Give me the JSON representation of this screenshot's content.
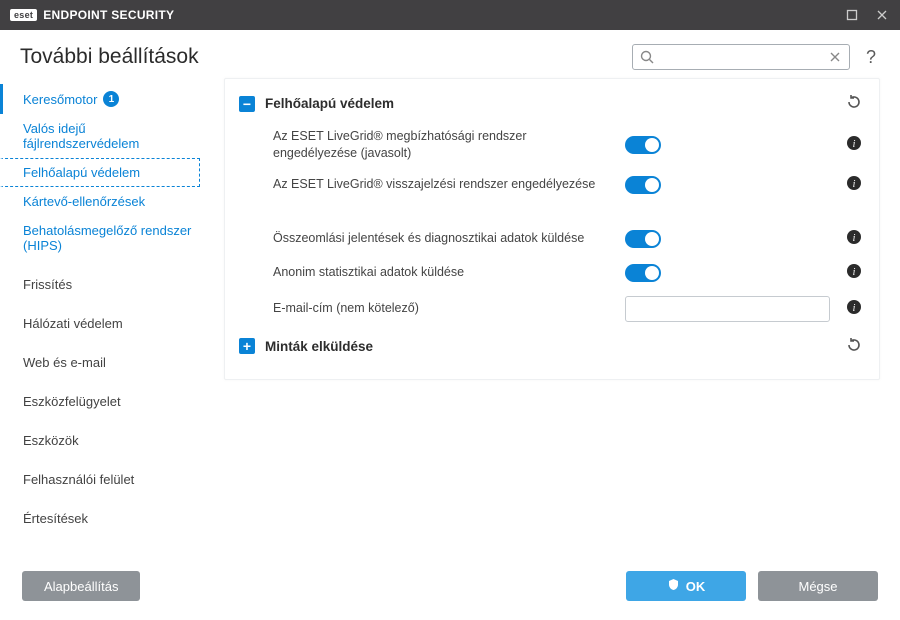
{
  "title_bar": {
    "brand_badge": "eset",
    "brand_text": "ENDPOINT SECURITY"
  },
  "header": {
    "title": "További beállítások",
    "help": "?",
    "search": {
      "value": "",
      "placeholder": ""
    }
  },
  "sidebar": {
    "engine": {
      "label": "Keresőmotor",
      "badge": "1"
    },
    "realtime": {
      "label": "Valós idejű fájlrendszervédelem"
    },
    "cloud": {
      "label": "Felhőalapú védelem"
    },
    "malware": {
      "label": "Kártevő-ellenőrzések"
    },
    "hips": {
      "label": "Behatolásmegelőző rendszer (HIPS)"
    },
    "update": {
      "label": "Frissítés"
    },
    "network": {
      "label": "Hálózati védelem"
    },
    "web": {
      "label": "Web és e-mail"
    },
    "device": {
      "label": "Eszközfelügyelet"
    },
    "tools": {
      "label": "Eszközök"
    },
    "ui": {
      "label": "Felhasználói felület"
    },
    "notif": {
      "label": "Értesítések"
    }
  },
  "section1": {
    "title": "Felhőalapú védelem",
    "rows": {
      "livegrid_rep": "Az ESET LiveGrid® megbízhatósági rendszer engedélyezése (javasolt)",
      "livegrid_feedback": "Az ESET LiveGrid® visszajelzési rendszer engedélyezése",
      "crash": "Összeomlási jelentések és diagnosztikai adatok küldése",
      "anon": "Anonim statisztikai adatok küldése",
      "email": "E-mail-cím (nem kötelező)"
    }
  },
  "section2": {
    "title": "Minták elküldése"
  },
  "footer": {
    "default": "Alapbeállítás",
    "ok": "OK",
    "cancel": "Mégse"
  }
}
